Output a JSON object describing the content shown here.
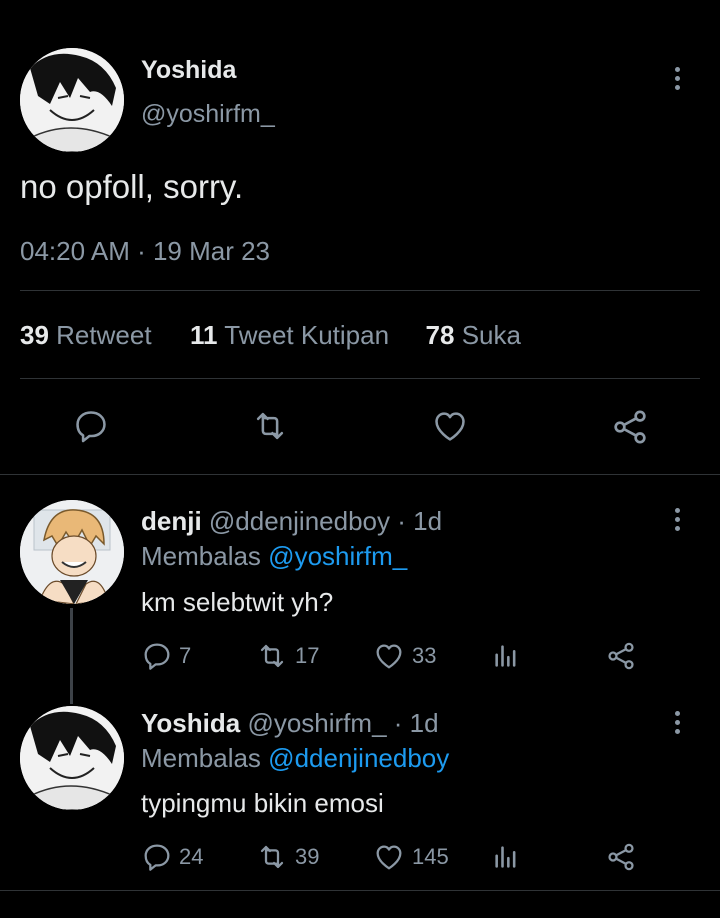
{
  "main_tweet": {
    "name": "Yoshida",
    "handle": "@yoshirfm_",
    "text": "no opfoll, sorry.",
    "timestamp": "04:20 AM · 19 Mar 23",
    "stats": {
      "retweets": "39",
      "retweets_label": "Retweet",
      "quotes": "11",
      "quotes_label": "Tweet Kutipan",
      "likes": "78",
      "likes_label": "Suka"
    }
  },
  "replies": [
    {
      "name": "denji",
      "handle": "@ddenjinedboy",
      "time": "· 1d",
      "replying_prefix": "Membalas",
      "replying_to": "@yoshirfm_",
      "text": "km selebtwit yh?",
      "replies": "7",
      "retweets": "17",
      "likes": "33"
    },
    {
      "name": "Yoshida",
      "handle": "@yoshirfm_",
      "time": "· 1d",
      "replying_prefix": "Membalas",
      "replying_to": "@ddenjinedboy",
      "text": "typingmu bikin emosi",
      "replies": "24",
      "retweets": "39",
      "likes": "145"
    }
  ],
  "icons": {
    "reply": "reply-icon",
    "retweet": "retweet-icon",
    "like": "heart-icon",
    "share": "share-icon",
    "analytics": "analytics-icon",
    "more": "more-icon"
  },
  "colors": {
    "background": "#000000",
    "text": "#e7e9ea",
    "secondary": "#8b98a5",
    "link": "#1d9bf0",
    "divider": "#2f3336"
  }
}
